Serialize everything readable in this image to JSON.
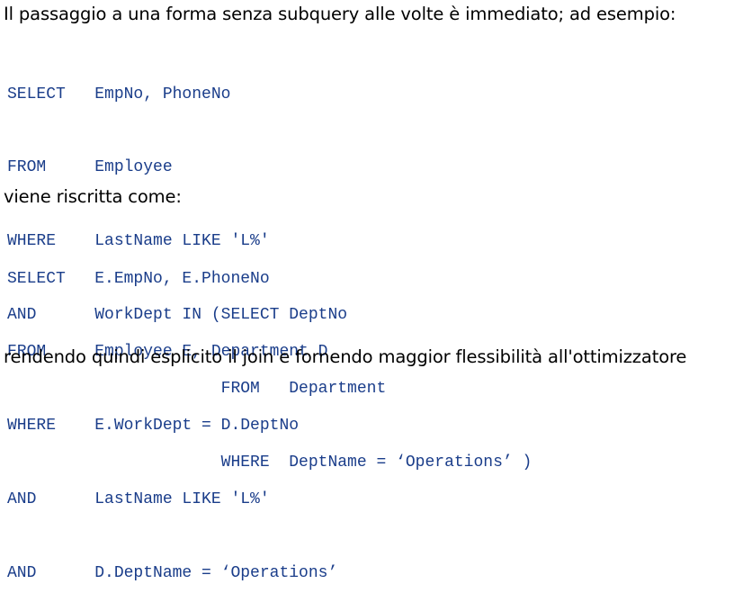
{
  "text": {
    "intro": "Il passaggio a una forma senza subquery alle volte è immediato; ad esempio:",
    "middle": "viene riscritta come:",
    "outro": "rendendo quindi esplicito il join e fornendo maggior flessibilità all'ottimizzatore"
  },
  "colors": {
    "code": "#1a3d8a",
    "prose": "#000000"
  },
  "query_original": [
    "SELECT   EmpNo, PhoneNo",
    "FROM     Employee",
    "WHERE    LastName LIKE 'L%'",
    "AND      WorkDept IN (SELECT DeptNo",
    "                      FROM   Department",
    "                      WHERE  DeptName = ‘Operations’ )"
  ],
  "query_rewritten": [
    "SELECT   E.EmpNo, E.PhoneNo",
    "FROM     Employee E, Department D",
    "WHERE    E.WorkDept = D.DeptNo",
    "AND      LastName LIKE 'L%'",
    "AND      D.DeptName = ‘Operations’"
  ]
}
